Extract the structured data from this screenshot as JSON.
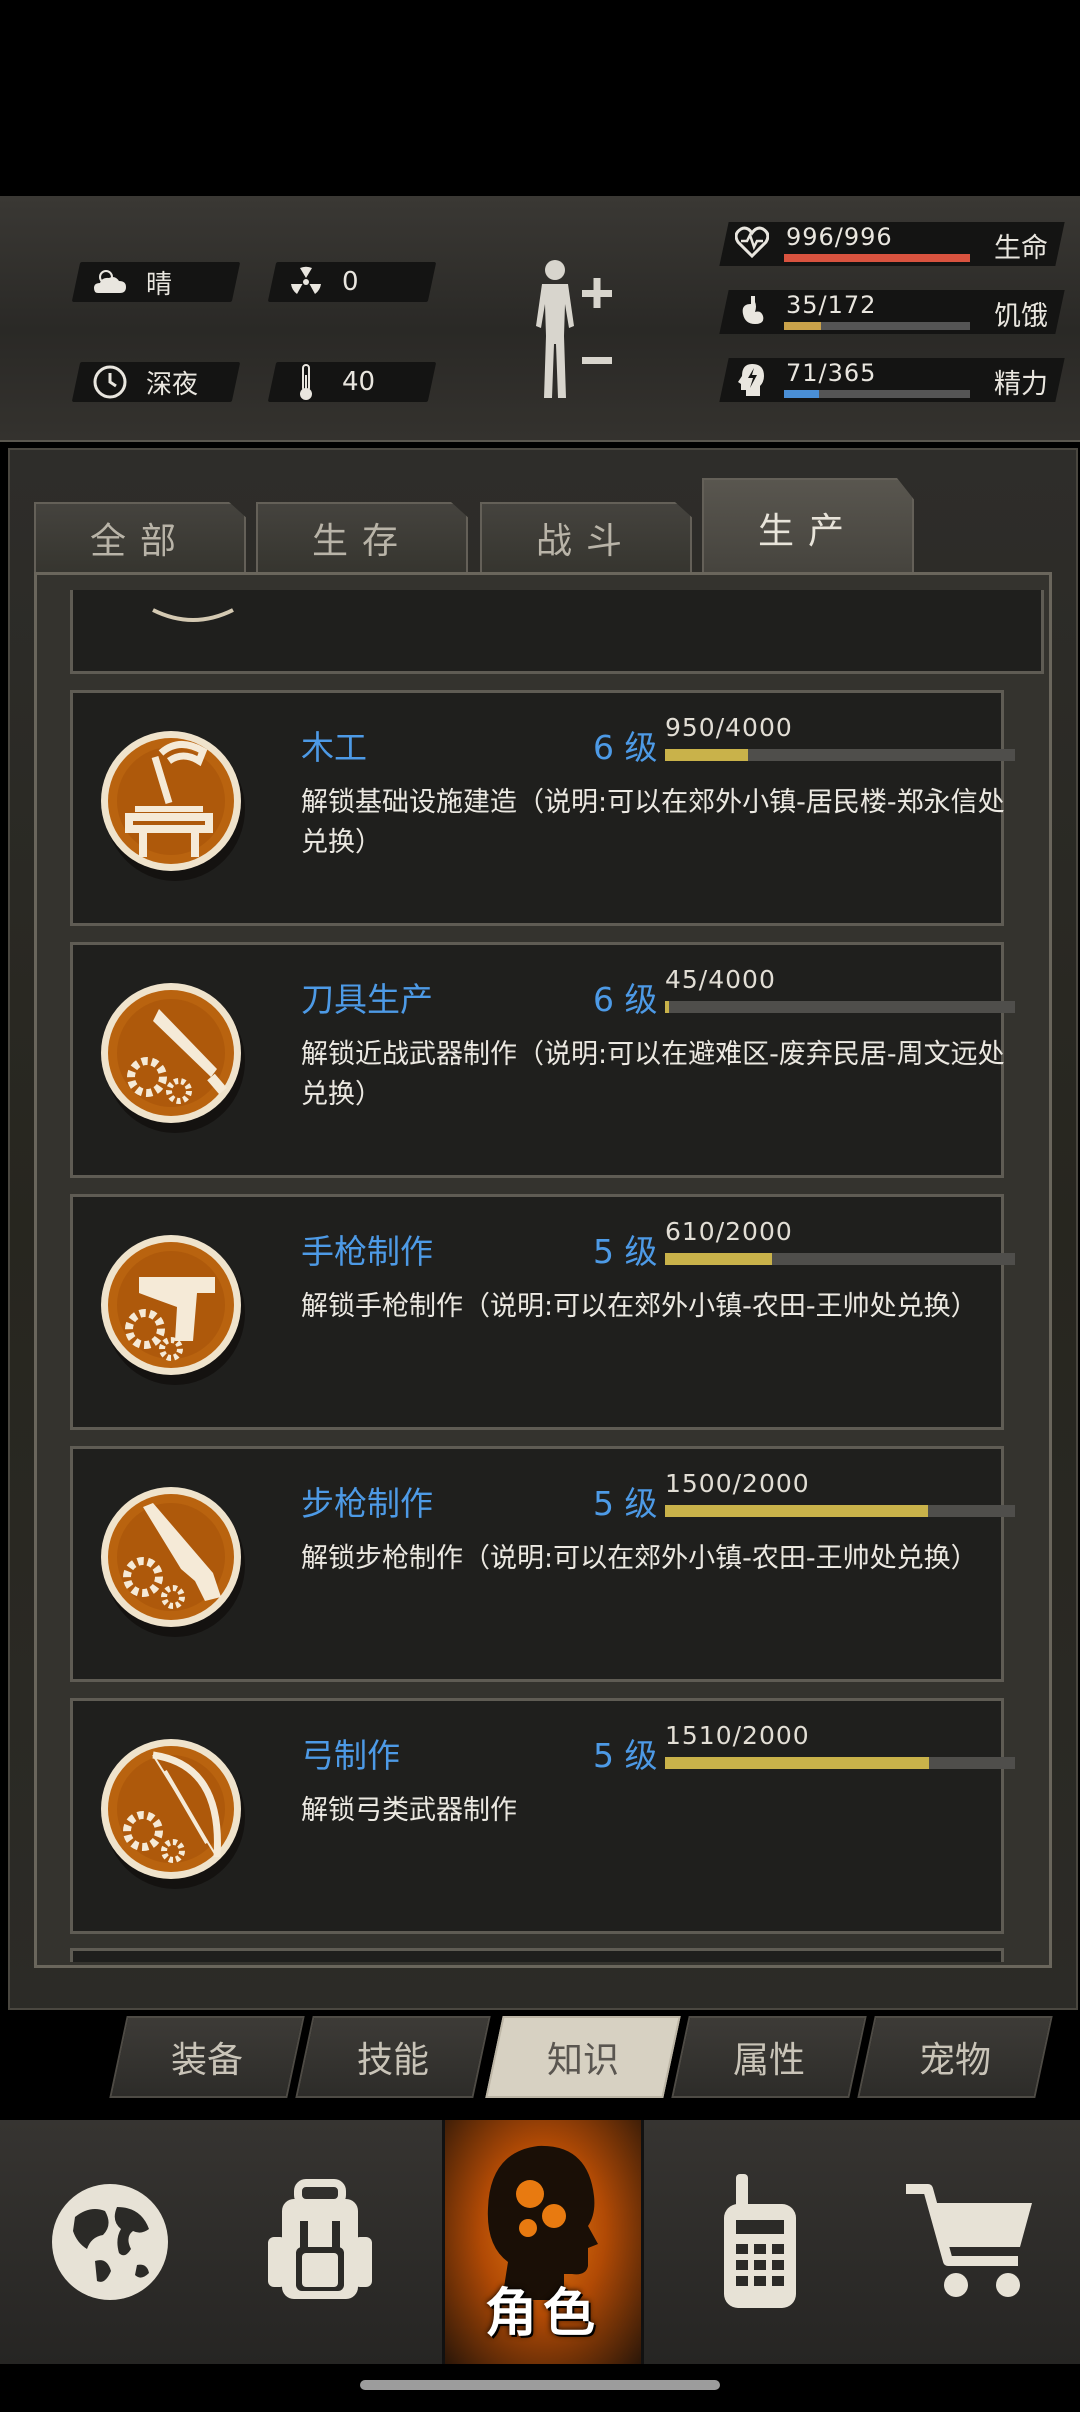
{
  "environment": {
    "weather": "晴",
    "radiation": "0",
    "time_of_day": "深夜",
    "temperature": "40"
  },
  "stats": [
    {
      "icon": "heart-pulse-icon",
      "value": "996/996",
      "label": "生命",
      "fill": 1.0,
      "color": "#d9533f"
    },
    {
      "icon": "stomach-icon",
      "value": "35/172",
      "label": "饥饿",
      "fill": 0.2,
      "color": "#c9a24a"
    },
    {
      "icon": "head-lightning-icon",
      "value": "71/365",
      "label": "精力",
      "fill": 0.19,
      "color": "#4a8fd6"
    }
  ],
  "category_tabs": [
    {
      "label": "全部",
      "active": false
    },
    {
      "label": "生存",
      "active": false
    },
    {
      "label": "战斗",
      "active": false
    },
    {
      "label": "生产",
      "active": true
    }
  ],
  "skills": [
    {
      "icon": "carpentry-icon",
      "name": "木工",
      "level": "6 级",
      "progress": "950/4000",
      "fill": 0.2375,
      "desc": "解锁基础设施建造（说明:可以在郊外小镇-居民楼-郑永信处兑换）"
    },
    {
      "icon": "knife-crafting-icon",
      "name": "刀具生产",
      "level": "6 级",
      "progress": "45/4000",
      "fill": 0.011,
      "desc": "解锁近战武器制作（说明:可以在避难区-废弃民居-周文远处兑换）"
    },
    {
      "icon": "pistol-crafting-icon",
      "name": "手枪制作",
      "level": "5 级",
      "progress": "610/2000",
      "fill": 0.305,
      "desc": "解锁手枪制作（说明:可以在郊外小镇-农田-王帅处兑换）"
    },
    {
      "icon": "rifle-crafting-icon",
      "name": "步枪制作",
      "level": "5 级",
      "progress": "1500/2000",
      "fill": 0.75,
      "desc": "解锁步枪制作（说明:可以在郊外小镇-农田-王帅处兑换）"
    },
    {
      "icon": "bow-crafting-icon",
      "name": "弓制作",
      "level": "5 级",
      "progress": "1510/2000",
      "fill": 0.755,
      "desc": "解锁弓类武器制作"
    }
  ],
  "sub_tabs": [
    {
      "label": "装备",
      "active": false
    },
    {
      "label": "技能",
      "active": false
    },
    {
      "label": "知识",
      "active": true
    },
    {
      "label": "属性",
      "active": false
    },
    {
      "label": "宠物",
      "active": false
    }
  ],
  "bottom_nav": {
    "map": "globe-icon",
    "backpack": "backpack-icon",
    "character_label": "角色",
    "radio": "walkie-talkie-icon",
    "shop": "shopping-cart-icon"
  }
}
